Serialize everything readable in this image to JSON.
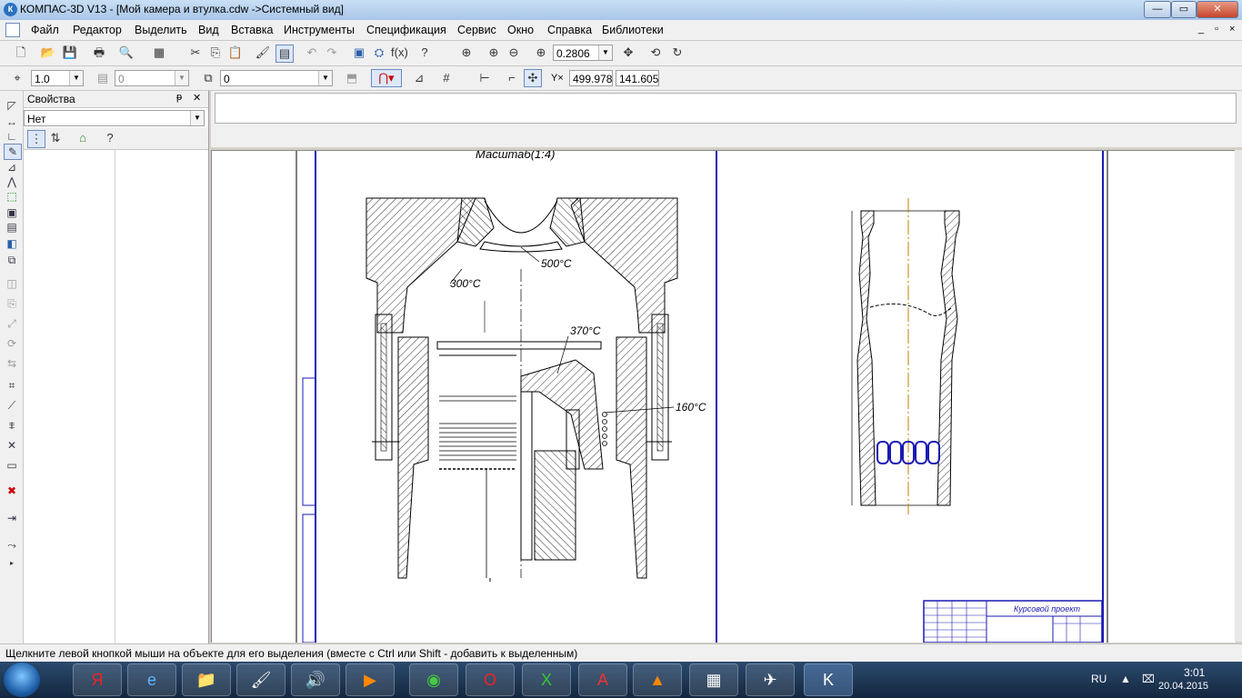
{
  "window": {
    "title": "КОМПАС-3D V13 - [Мой камера и втулка.cdw ->Системный вид]",
    "app_icon": "К",
    "buttons": [
      "—",
      "▭",
      "✕"
    ]
  },
  "menu": {
    "items": [
      "Файл",
      "Редактор",
      "Выделить",
      "Вид",
      "Вставка",
      "Инструменты",
      "Спецификация",
      "Сервис",
      "Окно",
      "Справка",
      "Библиотеки"
    ],
    "mdi_buttons": [
      "_",
      "▫",
      "×"
    ]
  },
  "toolbar1": {
    "zoom_value": "0.2806"
  },
  "toolbar2": {
    "step_value": "1.0",
    "layer_value": "0",
    "style_value": "0",
    "coord_label": "Y×",
    "coord_x": "499.978",
    "coord_y": "141.605"
  },
  "properties": {
    "title": "Свойства",
    "pin": "ᵽ",
    "close": "✕",
    "dropdown_value": "Нет"
  },
  "drawing": {
    "scale_label": "Масштаб(1:4)",
    "temp_500": "500°C",
    "temp_300": "300°C",
    "temp_370": "370°C",
    "temp_160": "160°C",
    "title_block_text": "Курсовой проект",
    "colors": {
      "frame": "#1a1ab4",
      "line": "#000000",
      "axis": "#c08000"
    }
  },
  "status": {
    "text": "Щелкните левой кнопкой мыши на объекте для его выделения (вместе с Ctrl или Shift - добавить к выделенным)"
  },
  "taskbar": {
    "apps": [
      "Я",
      "e",
      "📁",
      "🖌",
      "🔊",
      "▶",
      "◉",
      "O",
      "X",
      "A",
      "▲",
      "▦",
      "✈",
      "K"
    ],
    "lang": "RU",
    "time": "3:01",
    "date": "20.04.2015"
  }
}
